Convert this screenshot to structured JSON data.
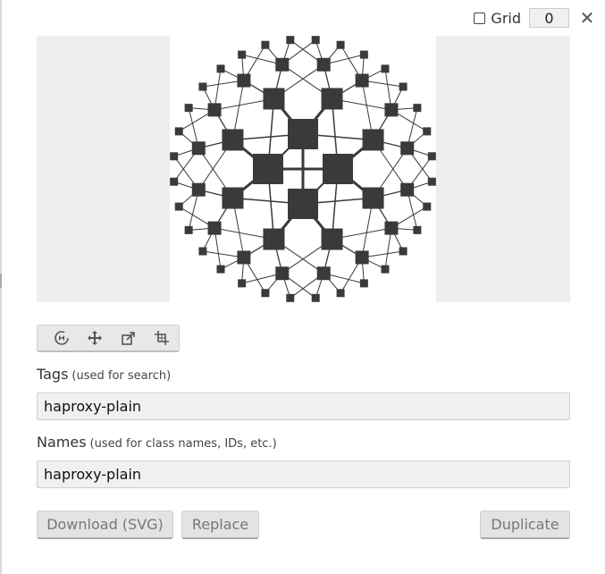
{
  "grid": {
    "label": "Grid",
    "value": "0",
    "checked": false
  },
  "close_label": "✕",
  "preview": {
    "icon_name": "haproxy-plain",
    "icon_color": "#3a3a3a"
  },
  "toolbar": {
    "tools": [
      {
        "name": "rotate",
        "icon": "rotate-icon"
      },
      {
        "name": "move",
        "icon": "move-icon"
      },
      {
        "name": "resize",
        "icon": "resize-icon"
      },
      {
        "name": "crop",
        "icon": "crop-icon"
      }
    ]
  },
  "tags": {
    "label": "Tags",
    "hint": "(used for search)",
    "value": "haproxy-plain"
  },
  "names": {
    "label": "Names",
    "hint": "(used for class names, IDs, etc.)",
    "value": "haproxy-plain"
  },
  "buttons": {
    "download": "Download (SVG)",
    "replace": "Replace",
    "duplicate": "Duplicate"
  }
}
